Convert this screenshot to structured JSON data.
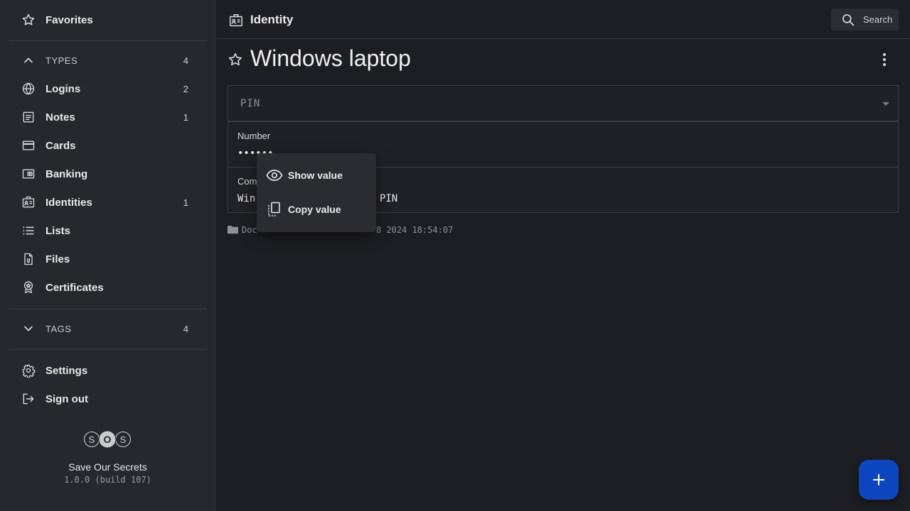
{
  "app": {
    "name": "Save Our Secrets",
    "version": "1.0.0 (build 107)",
    "logo_letters": [
      "S",
      "O",
      "S"
    ]
  },
  "sidebar": {
    "favorites": {
      "label": "Favorites",
      "icon": "star-icon"
    },
    "types": {
      "label": "TYPES",
      "count": "4",
      "icon": "chevron-up-icon"
    },
    "items": [
      {
        "label": "Logins",
        "count": "2",
        "icon": "globe-icon"
      },
      {
        "label": "Notes",
        "count": "1",
        "icon": "note-icon"
      },
      {
        "label": "Cards",
        "count": "",
        "icon": "credit-card-icon"
      },
      {
        "label": "Banking",
        "count": "",
        "icon": "wallet-icon"
      },
      {
        "label": "Identities",
        "count": "1",
        "icon": "id-badge-icon"
      },
      {
        "label": "Lists",
        "count": "",
        "icon": "list-icon"
      },
      {
        "label": "Files",
        "count": "",
        "icon": "file-icon"
      },
      {
        "label": "Certificates",
        "count": "",
        "icon": "award-icon"
      }
    ],
    "tags": {
      "label": "TAGS",
      "count": "4",
      "icon": "chevron-down-icon"
    },
    "settings": {
      "label": "Settings",
      "icon": "gear-icon"
    },
    "sign_out": {
      "label": "Sign out",
      "icon": "sign-out-icon"
    }
  },
  "header": {
    "title": "Identity",
    "search_label": "Search"
  },
  "entry": {
    "title": "Windows laptop",
    "id_type": "PIN",
    "fields": [
      {
        "label": "Number",
        "value": "••••••"
      },
      {
        "label": "Comm",
        "value_start": "Win",
        "value_end": "PIN"
      }
    ],
    "folder": "Doc",
    "date": "8 2024 18:54:07"
  },
  "context_menu": {
    "items": [
      {
        "label": "Show value",
        "icon": "eye-icon"
      },
      {
        "label": "Copy value",
        "icon": "copy-icon"
      }
    ]
  },
  "fab": {
    "icon": "plus-icon"
  },
  "colors": {
    "accent": "#0d47c0",
    "sidebar_bg": "#26282d",
    "main_bg": "#1d1e23"
  }
}
